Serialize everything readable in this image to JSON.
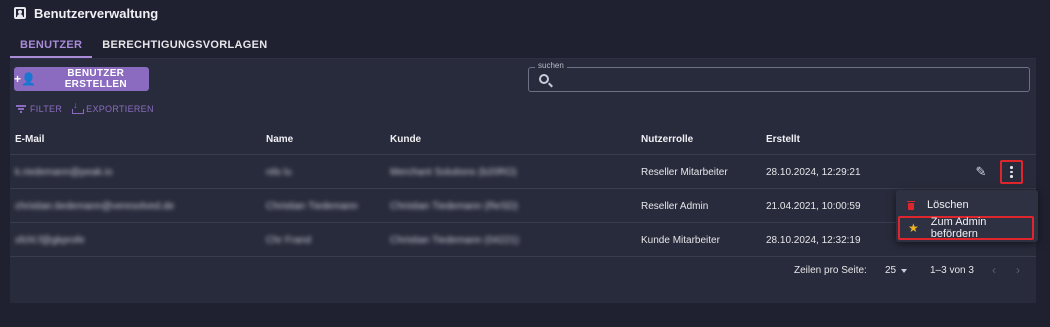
{
  "page": {
    "title": "Benutzerverwaltung"
  },
  "tabs": [
    {
      "label": "BENUTZER",
      "active": true
    },
    {
      "label": "BERECHTIGUNGSVORLAGEN",
      "active": false
    }
  ],
  "toolbar": {
    "create_label": "BENUTZER ERSTELLEN",
    "filter_label": "FILTER",
    "export_label": "EXPORTIEREN"
  },
  "search": {
    "label": "suchen",
    "value": ""
  },
  "table": {
    "columns": [
      "E-Mail",
      "Name",
      "Kunde",
      "Nutzerrolle",
      "Erstellt"
    ],
    "rows": [
      {
        "email": "k.riedemann@peak.io",
        "name": "nils lu",
        "kunde": "Merchant Solutions (b20RO)",
        "role": "Reseller Mitarbeiter",
        "created": "28.10.2024, 12:29:21"
      },
      {
        "email": "christian.tiedemann@veresolved.de",
        "name": "Christian Tiedemann",
        "kunde": "Christian Tiedemann (ReSD)",
        "role": "Reseller Admin",
        "created": "21.04.2021, 10:00:59"
      },
      {
        "email": "xfchl.f@gkprofe",
        "name": "Chr Frand",
        "kunde": "Christian Tiedemann (04221)",
        "role": "Kunde Mitarbeiter",
        "created": "28.10.2024, 12:32:19"
      }
    ]
  },
  "pagination": {
    "rows_per_page_label": "Zeilen pro Seite:",
    "rows_per_page": "25",
    "range": "1–3 von 3"
  },
  "context_menu": {
    "items": [
      {
        "label": "Löschen",
        "icon": "trash-icon"
      },
      {
        "label": "Zum Admin befördern",
        "icon": "star-icon"
      }
    ]
  },
  "colors": {
    "accent": "#8a6bbf",
    "highlight": "#e0262d",
    "star": "#f0b31e",
    "delete": "#e0262d"
  }
}
